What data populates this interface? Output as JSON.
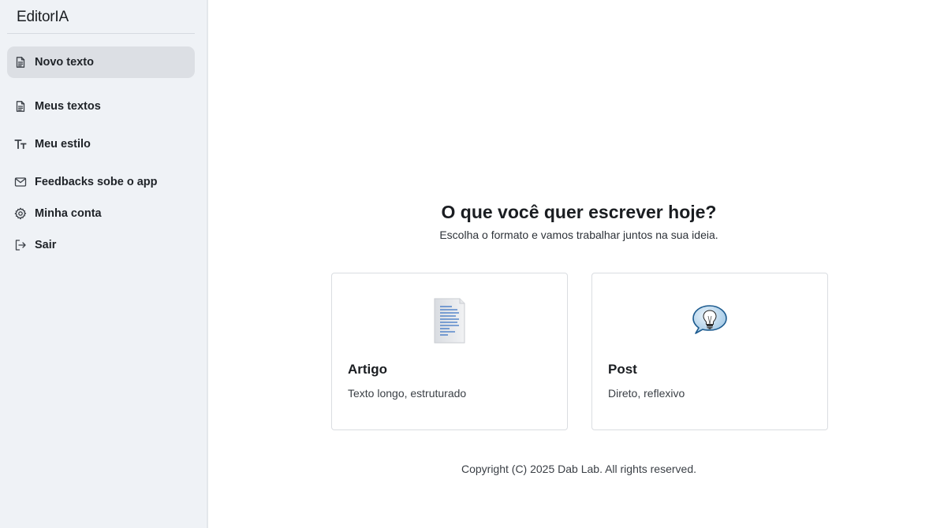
{
  "sidebar": {
    "brand": "EditorIA",
    "items": [
      {
        "label": "Novo texto",
        "icon": "document-icon",
        "active": true
      },
      {
        "label": "Meus textos",
        "icon": "document-icon",
        "active": false
      },
      {
        "label": "Meu estilo",
        "icon": "text-size-icon",
        "active": false
      },
      {
        "label": "Feedbacks sobe o app",
        "icon": "mail-icon",
        "active": false
      },
      {
        "label": "Minha conta",
        "icon": "gear-icon",
        "active": false
      },
      {
        "label": "Sair",
        "icon": "logout-icon",
        "active": false
      }
    ]
  },
  "main": {
    "headline": "O que você quer escrever hoje?",
    "subline": "Escolha o formato e vamos trabalhar juntos na sua ideia.",
    "cards": [
      {
        "title": "Artigo",
        "description": "Texto longo, estruturado",
        "icon": "document-page-icon"
      },
      {
        "title": "Post",
        "description": "Direto, reflexivo",
        "icon": "lightbulb-speech-icon"
      }
    ],
    "copyright": "Copyright (C) 2025 Dab Lab. All rights reserved."
  },
  "colors": {
    "sidebar_bg": "#eff2f6",
    "active_item_bg": "#dcdfe4",
    "card_border": "#dadde1",
    "doc_lines": "#3b73c4"
  }
}
